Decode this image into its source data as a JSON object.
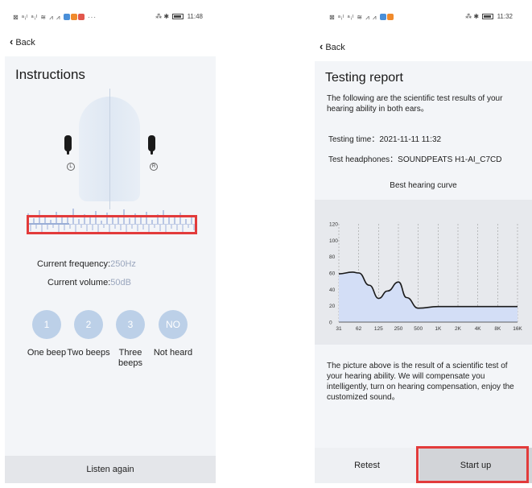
{
  "left": {
    "status": {
      "left": "⊠ ᵃᵢˡ ᵃᵢˡ ≋ ⩘ ⩘",
      "time": "11:48"
    },
    "back_label": "Back",
    "title": "Instructions",
    "ear_left": "L",
    "ear_right": "R",
    "frequency_label": "Current frequency:",
    "frequency_value": "250Hz",
    "volume_label": "Current volume:",
    "volume_value": "50dB",
    "options": [
      {
        "num": "1",
        "label": "One beep"
      },
      {
        "num": "2",
        "label": "Two beeps"
      },
      {
        "num": "3",
        "label": "Three beeps"
      },
      {
        "num": "NO",
        "label": "Not heard"
      }
    ],
    "listen_again": "Listen again"
  },
  "right": {
    "status": {
      "left": "⊠ ᵃᵢˡ ᵃᵢˡ ≋ ⩘ ⩘",
      "time": "11:32"
    },
    "back_label": "Back",
    "title": "Testing report",
    "intro": "The following are the scientific test results of your hearing ability in both ears。",
    "testing_time_label": "Testing time：",
    "testing_time_value": "2021-11-11 11:32",
    "headphones_label": "Test headphones：",
    "headphones_value": "SOUNDPEATS H1-AI_C7CD",
    "chart_title": "Best hearing curve",
    "explanation": "The picture above is the result of a scientific test of your hearing ability. We will compensate you intelligently, turn on hearing compensation, enjoy the customized sound。",
    "retest": "Retest",
    "start_up": "Start up"
  },
  "colors": {
    "accent_circle": "#bcd0e8",
    "highlight": "#e23b3b",
    "curve_fill": "#d3def6"
  },
  "chart_data": {
    "type": "area",
    "title": "Best hearing curve",
    "categories": [
      "31",
      "62",
      "125",
      "250",
      "500",
      "1K",
      "2K",
      "4K",
      "8K",
      "16K"
    ],
    "y_ticks": [
      0,
      20,
      40,
      60,
      80,
      100,
      120
    ],
    "ylim": [
      0,
      120
    ],
    "x": [
      31,
      50,
      62,
      90,
      125,
      170,
      250,
      330,
      500,
      1000,
      2000,
      4000,
      8000,
      16000
    ],
    "values": [
      59,
      61,
      60,
      45,
      29,
      38,
      49,
      30,
      17,
      19,
      19,
      19,
      19,
      19
    ],
    "grid": "vertical dashed"
  }
}
